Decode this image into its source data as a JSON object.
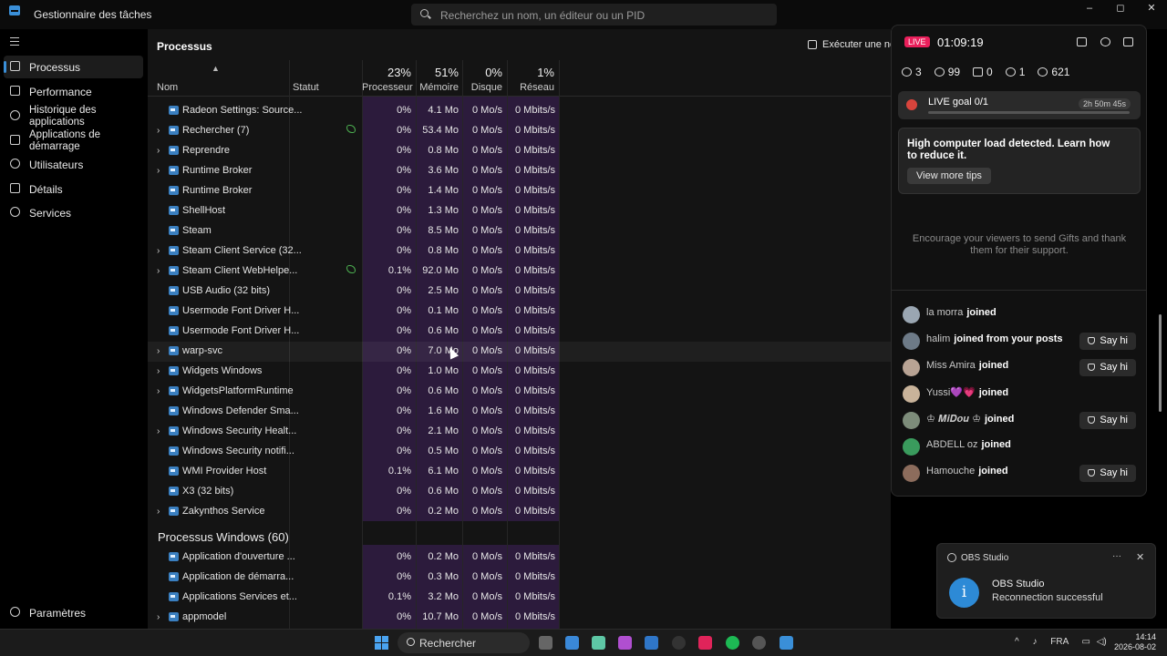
{
  "window": {
    "title": "Gestionnaire des tâches",
    "controls": [
      "–",
      "◻",
      "✕"
    ]
  },
  "search": {
    "placeholder": "Recherchez un nom, un éditeur ou un PID"
  },
  "sidebar": {
    "items": [
      {
        "label": "Processus",
        "active": true
      },
      {
        "label": "Performance"
      },
      {
        "label": "Historique des applications"
      },
      {
        "label": "Applications de démarrage"
      },
      {
        "label": "Utilisateurs"
      },
      {
        "label": "Détails"
      },
      {
        "label": "Services"
      }
    ],
    "settings": "Paramètres"
  },
  "main": {
    "title": "Processus",
    "run_task": "Exécuter une nouvelle tâche",
    "columns": {
      "name": "Nom",
      "status": "Statut",
      "cpu_pct": "23%",
      "cpu": "Processeur",
      "mem_pct": "51%",
      "mem": "Mémoire",
      "disk_pct": "0%",
      "disk": "Disque",
      "net_pct": "1%",
      "net": "Réseau"
    },
    "rows": [
      {
        "name": "Radeon Settings: Source...",
        "cpu": "0%",
        "mem": "4.1 Mo",
        "disk": "0 Mo/s",
        "net": "0 Mbits/s",
        "expand": false
      },
      {
        "name": "Rechercher (7)",
        "cpu": "0%",
        "mem": "53.4 Mo",
        "disk": "0 Mo/s",
        "net": "0 Mbits/s",
        "expand": true,
        "leaf": true
      },
      {
        "name": "Reprendre",
        "cpu": "0%",
        "mem": "0.8 Mo",
        "disk": "0 Mo/s",
        "net": "0 Mbits/s",
        "expand": true
      },
      {
        "name": "Runtime Broker",
        "cpu": "0%",
        "mem": "3.6 Mo",
        "disk": "0 Mo/s",
        "net": "0 Mbits/s",
        "expand": true
      },
      {
        "name": "Runtime Broker",
        "cpu": "0%",
        "mem": "1.4 Mo",
        "disk": "0 Mo/s",
        "net": "0 Mbits/s",
        "expand": false
      },
      {
        "name": "ShellHost",
        "cpu": "0%",
        "mem": "1.3 Mo",
        "disk": "0 Mo/s",
        "net": "0 Mbits/s",
        "expand": false
      },
      {
        "name": "Steam",
        "cpu": "0%",
        "mem": "8.5 Mo",
        "disk": "0 Mo/s",
        "net": "0 Mbits/s",
        "expand": false
      },
      {
        "name": "Steam Client Service (32...",
        "cpu": "0%",
        "mem": "0.8 Mo",
        "disk": "0 Mo/s",
        "net": "0 Mbits/s",
        "expand": true
      },
      {
        "name": "Steam Client WebHelpe...",
        "cpu": "0.1%",
        "mem": "92.0 Mo",
        "disk": "0 Mo/s",
        "net": "0 Mbits/s",
        "expand": true,
        "leaf": true
      },
      {
        "name": "USB Audio (32 bits)",
        "cpu": "0%",
        "mem": "2.5 Mo",
        "disk": "0 Mo/s",
        "net": "0 Mbits/s",
        "expand": false
      },
      {
        "name": "Usermode Font Driver H...",
        "cpu": "0%",
        "mem": "0.1 Mo",
        "disk": "0 Mo/s",
        "net": "0 Mbits/s",
        "expand": false
      },
      {
        "name": "Usermode Font Driver H...",
        "cpu": "0%",
        "mem": "0.6 Mo",
        "disk": "0 Mo/s",
        "net": "0 Mbits/s",
        "expand": false
      },
      {
        "name": "warp-svc",
        "cpu": "0%",
        "mem": "7.0 Mo",
        "disk": "0 Mo/s",
        "net": "0 Mbits/s",
        "expand": true,
        "highlight": true
      },
      {
        "name": "Widgets Windows",
        "cpu": "0%",
        "mem": "1.0 Mo",
        "disk": "0 Mo/s",
        "net": "0 Mbits/s",
        "expand": true
      },
      {
        "name": "WidgetsPlatformRuntime",
        "cpu": "0%",
        "mem": "0.6 Mo",
        "disk": "0 Mo/s",
        "net": "0 Mbits/s",
        "expand": true
      },
      {
        "name": "Windows Defender Sma...",
        "cpu": "0%",
        "mem": "1.6 Mo",
        "disk": "0 Mo/s",
        "net": "0 Mbits/s",
        "expand": false
      },
      {
        "name": "Windows Security Healt...",
        "cpu": "0%",
        "mem": "2.1 Mo",
        "disk": "0 Mo/s",
        "net": "0 Mbits/s",
        "expand": true
      },
      {
        "name": "Windows Security notifi...",
        "cpu": "0%",
        "mem": "0.5 Mo",
        "disk": "0 Mo/s",
        "net": "0 Mbits/s",
        "expand": false
      },
      {
        "name": "WMI Provider Host",
        "cpu": "0.1%",
        "mem": "6.1 Mo",
        "disk": "0 Mo/s",
        "net": "0 Mbits/s",
        "expand": false
      },
      {
        "name": "X3 (32 bits)",
        "cpu": "0%",
        "mem": "0.6 Mo",
        "disk": "0 Mo/s",
        "net": "0 Mbits/s",
        "expand": false
      },
      {
        "name": "Zakynthos Service",
        "cpu": "0%",
        "mem": "0.2 Mo",
        "disk": "0 Mo/s",
        "net": "0 Mbits/s",
        "expand": true
      }
    ],
    "section": "Processus Windows (60)",
    "rows2": [
      {
        "name": "Application d'ouverture ...",
        "cpu": "0%",
        "mem": "0.2 Mo",
        "disk": "0 Mo/s",
        "net": "0 Mbits/s",
        "expand": false
      },
      {
        "name": "Application de démarra...",
        "cpu": "0%",
        "mem": "0.3 Mo",
        "disk": "0 Mo/s",
        "net": "0 Mbits/s",
        "expand": false
      },
      {
        "name": "Applications Services et...",
        "cpu": "0.1%",
        "mem": "3.2 Mo",
        "disk": "0 Mo/s",
        "net": "0 Mbits/s",
        "expand": false
      },
      {
        "name": "appmodel",
        "cpu": "0%",
        "mem": "10.7 Mo",
        "disk": "0 Mo/s",
        "net": "0 Mbits/s",
        "expand": true
      }
    ]
  },
  "live": {
    "badge": "LIVE",
    "timer": "01:09:19",
    "stats": [
      "3",
      "99",
      "0",
      "1",
      "621"
    ],
    "goal_label": "LIVE goal 0/1",
    "goal_time": "2h 50m 45s",
    "goal_progress": 0,
    "tip": "High computer load detected. Learn how to reduce it.",
    "tip_button": "View more tips",
    "encourage": "Encourage your viewers to send Gifts and thank them for their support.",
    "feed": [
      {
        "name": "la morra",
        "action": "joined",
        "sayhi": false
      },
      {
        "name": "halim",
        "action": "joined from your posts",
        "sayhi": true
      },
      {
        "name": "Miss Amira",
        "action": "joined",
        "sayhi": true
      },
      {
        "name": "Yussi💜💗",
        "action": "joined",
        "sayhi": false
      },
      {
        "name": "♔ 𝑴𝒊𝑫𝒐𝒖 ♔",
        "action": "joined",
        "sayhi": true
      },
      {
        "name": "ABDELL oz",
        "action": "joined",
        "sayhi": false
      },
      {
        "name": "Hamouche",
        "action": "joined",
        "sayhi": true
      }
    ],
    "sayhi_label": "Say hi"
  },
  "toast": {
    "app": "OBS Studio",
    "title": "OBS Studio",
    "body": "Reconnection successful"
  },
  "taskbar": {
    "search": "Rechercher",
    "lang": "FRA",
    "time": "14:14",
    "date": "2026-08-02"
  }
}
